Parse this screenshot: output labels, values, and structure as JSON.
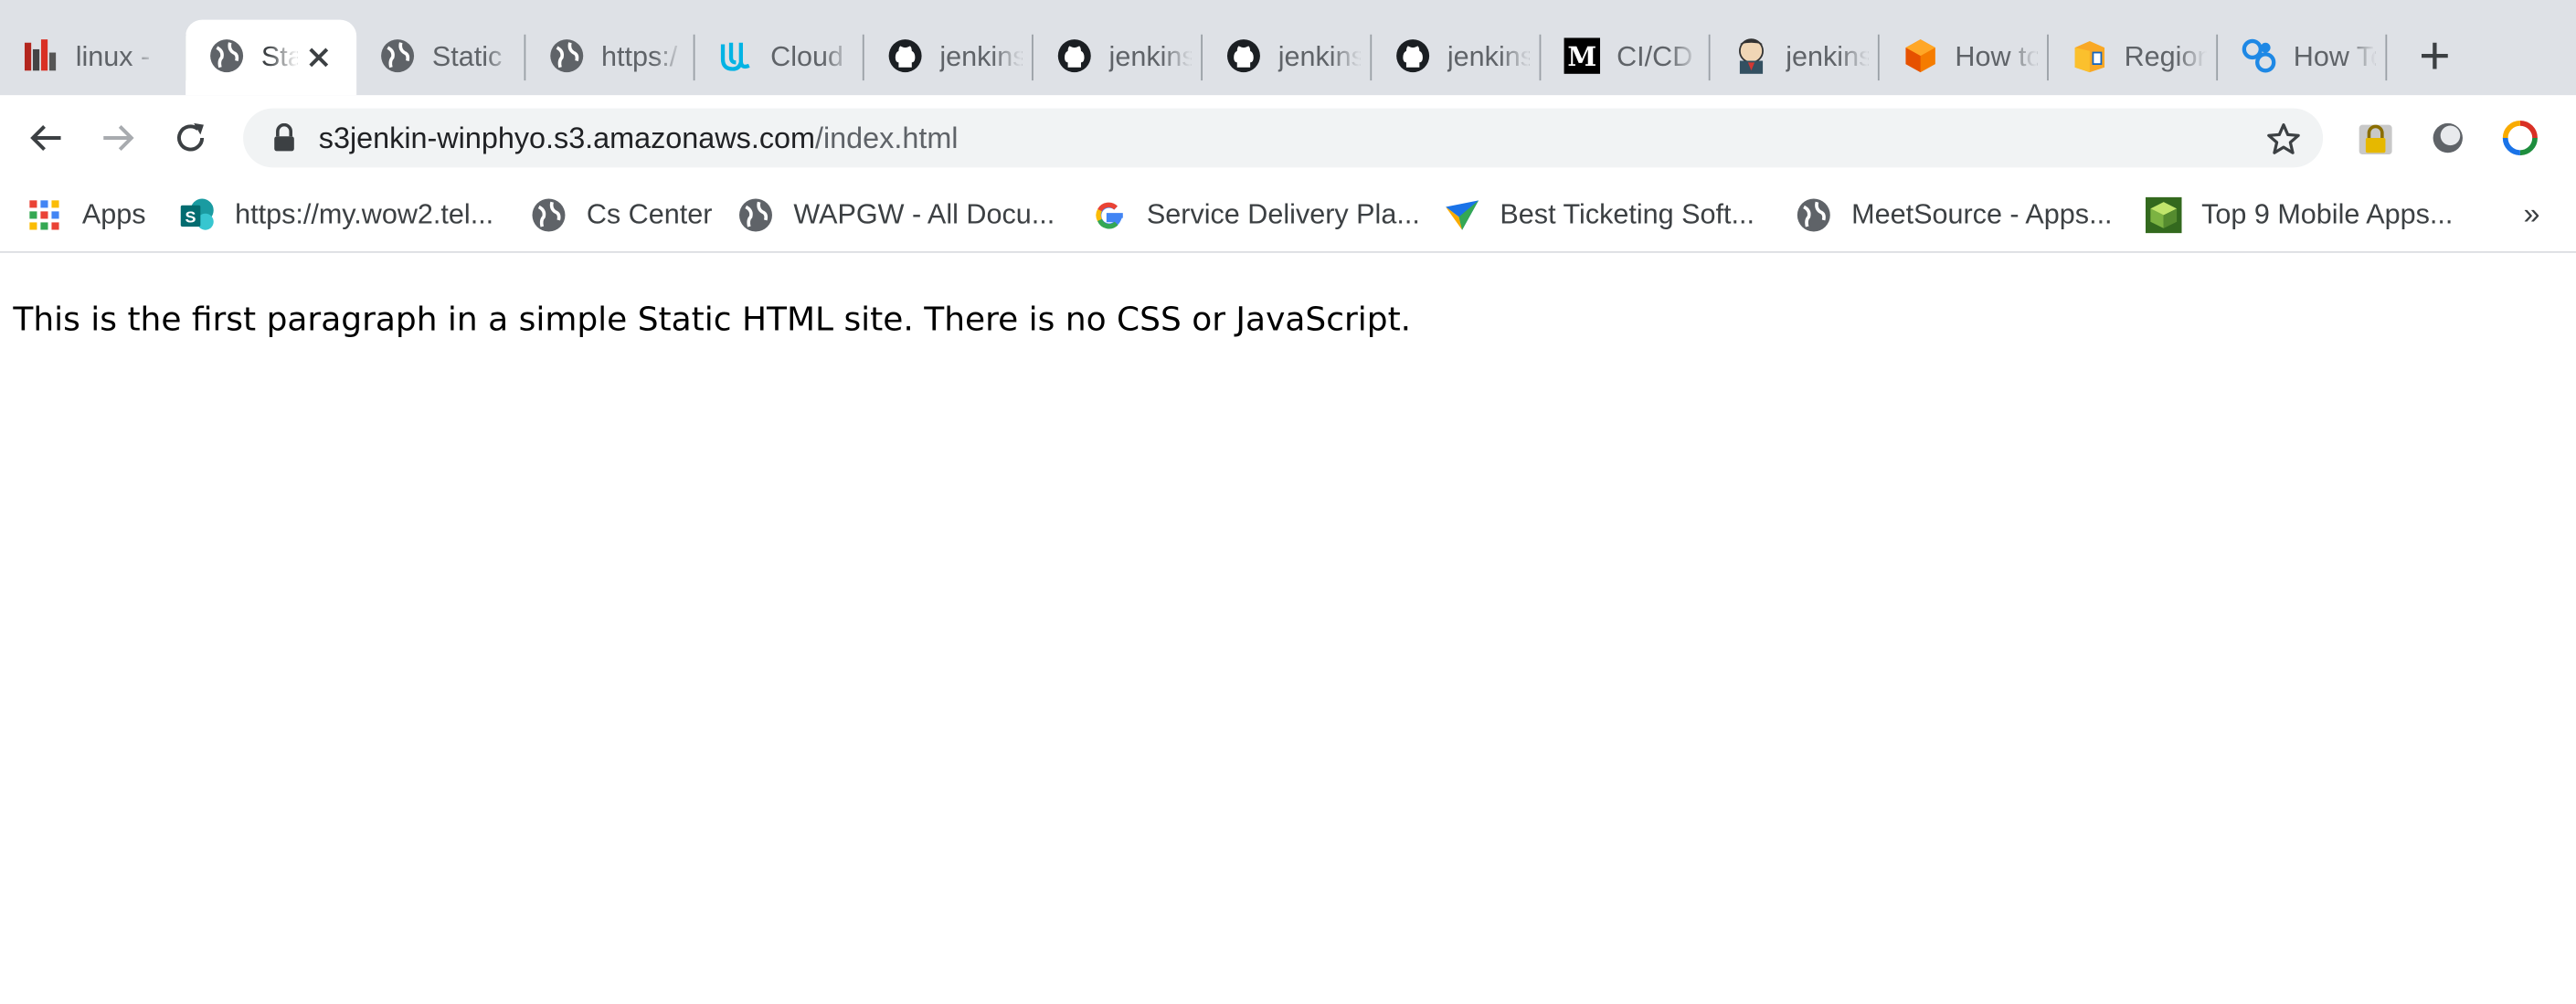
{
  "tabs": [
    {
      "title": "linux -",
      "icon": "bars-icon"
    },
    {
      "title": "Sta",
      "icon": "globe-icon",
      "active": true
    },
    {
      "title": "Static",
      "icon": "globe-icon"
    },
    {
      "title": "https:/",
      "icon": "globe-icon"
    },
    {
      "title": "Cloud",
      "icon": "udacity-icon"
    },
    {
      "title": "jenkins",
      "icon": "github-icon"
    },
    {
      "title": "jenkins",
      "icon": "github-icon"
    },
    {
      "title": "jenkins",
      "icon": "github-icon"
    },
    {
      "title": "jenkins",
      "icon": "github-icon"
    },
    {
      "title": "CI/CD",
      "icon": "medium-icon"
    },
    {
      "title": "jenkins",
      "icon": "jenkins-icon"
    },
    {
      "title": "How to",
      "icon": "box-icon"
    },
    {
      "title": "Region",
      "icon": "package-icon"
    },
    {
      "title": "How To",
      "icon": "blue-logo-icon"
    }
  ],
  "address_bar": {
    "host": "s3jenkin-winphyo.s3.amazonaws.com",
    "path": "/index.html"
  },
  "bookmarks": [
    {
      "label": "Apps",
      "icon": "apps-grid-icon"
    },
    {
      "label": "https://my.wow2.tel...",
      "icon": "sharepoint-icon"
    },
    {
      "label": "Cs Center",
      "icon": "globe-icon"
    },
    {
      "label": "WAPGW - All Docu...",
      "icon": "globe-icon"
    },
    {
      "label": "Service Delivery Pla...",
      "icon": "google-icon"
    },
    {
      "label": "Best Ticketing Soft...",
      "icon": "arrow-logo-icon"
    },
    {
      "label": "MeetSource - Apps...",
      "icon": "globe-icon"
    },
    {
      "label": "Top 9 Mobile Apps...",
      "icon": "green-cube-icon"
    }
  ],
  "bookmarks_overflow": "»",
  "page": {
    "paragraph": "This is the first paragraph in a simple Static HTML site. There is no CSS or JavaScript."
  },
  "colors": {
    "tabstrip": "#dee1e6",
    "omnibox": "#f1f3f4",
    "text": "#3c4043"
  }
}
